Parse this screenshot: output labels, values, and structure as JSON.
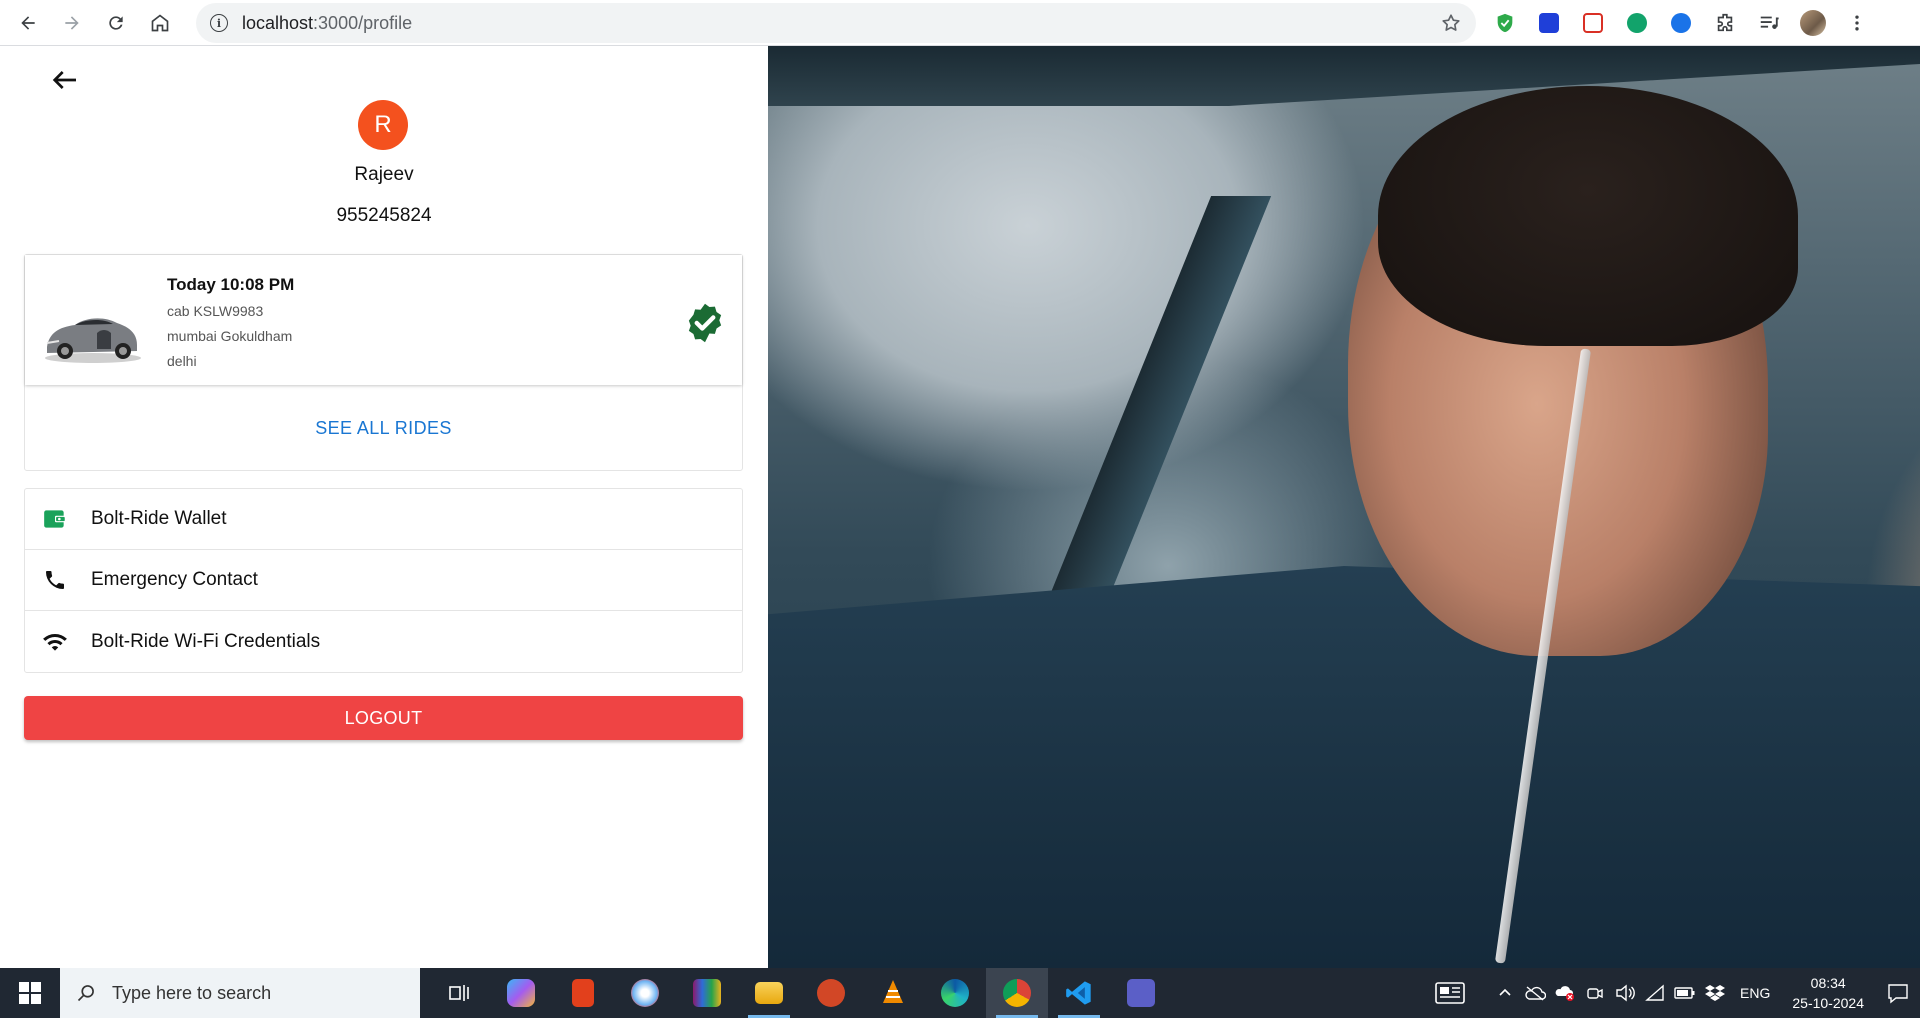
{
  "browser": {
    "url_host": "localhost",
    "url_path": ":3000/profile"
  },
  "profile": {
    "avatar_initial": "R",
    "name": "Rajeev",
    "phone": "955245824"
  },
  "ride": {
    "time": "Today 10:08 PM",
    "cab": "cab KSLW9983",
    "from": "mumbai Gokuldham",
    "to": "delhi",
    "status_icon": "verified-check-icon",
    "see_all_label": "SEE ALL RIDES"
  },
  "menu": {
    "items": [
      {
        "icon": "wallet-icon",
        "label": "Bolt-Ride Wallet"
      },
      {
        "icon": "phone-icon",
        "label": "Emergency Contact"
      },
      {
        "icon": "wifi-icon",
        "label": "Bolt-Ride Wi-Fi Credentials"
      }
    ]
  },
  "logout_label": "LOGOUT",
  "taskbar": {
    "search_placeholder": "Type here to search",
    "lang": "ENG",
    "time": "08:34",
    "date": "25-10-2024"
  },
  "colors": {
    "accent_blue": "#1976d2",
    "logout_red": "#ef4444",
    "avatar_orange": "#f4511e",
    "verified_green": "#1b6b34",
    "wallet_green": "#1aa25a"
  }
}
